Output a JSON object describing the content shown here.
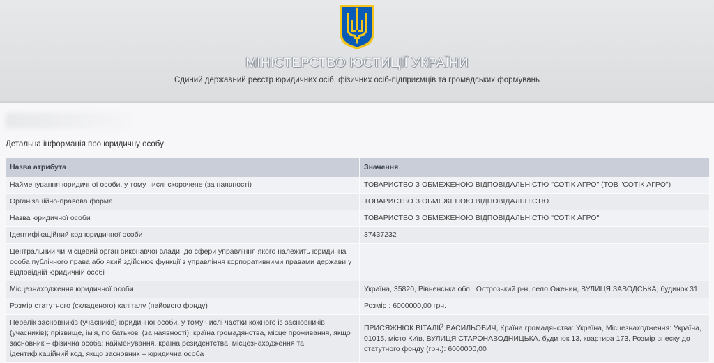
{
  "header": {
    "emblem": "trident-emblem-icon",
    "title": "МІНІСТЕРСТВО ЮСТИЦІЇ УКРАЇНИ",
    "subtitle": "Єдиний державний реєстр юридичних осіб, фізичних осіб-підприємців та громадських формувань"
  },
  "section": {
    "caption": "Детальна інформація про юридичну особу"
  },
  "table": {
    "headers": [
      "Назва атрибута",
      "Значення"
    ],
    "rows": [
      {
        "attribute": "Найменування юридичної особи, у тому числі скорочене (за наявності)",
        "value": "ТОВАРИСТВО З ОБМЕЖЕНОЮ ВІДПОВІДАЛЬНІСТЮ \"СОТІК АГРО\" (ТОВ \"СОТІК АГРО\")"
      },
      {
        "attribute": "Організаційно-правова форма",
        "value": "ТОВАРИСТВО З ОБМЕЖЕНОЮ ВІДПОВІДАЛЬНІСТЮ"
      },
      {
        "attribute": "Назва юридичної особи",
        "value": "ТОВАРИСТВО З ОБМЕЖЕНОЮ ВІДПОВІДАЛЬНІСТЮ \"СОТІК АГРО\""
      },
      {
        "attribute": "Ідентифікаційний код юридичної особи",
        "value": "37437232"
      },
      {
        "attribute": "Центральний чи місцевий орган виконавчої влади, до сфери управління якого належить юридична особа публічного права або який здійснює функції з управління корпоративними правами держави у відповідній юридичній особі",
        "value": ""
      },
      {
        "attribute": "Місцезнаходження юридичної особи",
        "value": "Україна, 35820, Рівненська обл., Острозький р-н, село Оженин, ВУЛИЦЯ ЗАВОДСЬКА, будинок 31"
      },
      {
        "attribute": "Розмір статутного (складеного) капіталу (пайового фонду)",
        "value": "Розмір : 6000000,00 грн."
      },
      {
        "attribute": "Перелік засновників (учасників) юридичної особи, у тому числі частки кожного із засновників (учасників); прізвище, ім'я, по батькові (за наявності), країна громадянства, місце проживання, якщо засновник – фізична особа; найменування, країна резидентства, місцезнаходження та ідентифікаційний код, якщо засновник – юридична особа",
        "value": "ПРИСЯЖНЮК ВІТАЛІЙ ВАСИЛЬОВИЧ, Країна громадянства: Україна, Місцезнаходження: Україна, 01015, місто Київ, ВУЛИЦЯ СТАРОНАВОДНИЦЬКА, будинок 13, квартира 173, Розмір внеску до статутного фонду (грн.): 6000000,00"
      }
    ]
  },
  "colors": {
    "header_bg": "#e1e2e4",
    "table_header_bg": "#c9ced8",
    "row_odd_bg": "#f1f2f5",
    "row_even_bg": "#e9ebef",
    "emblem_blue": "#0a5bb5",
    "emblem_gold": "#f6c51c"
  }
}
